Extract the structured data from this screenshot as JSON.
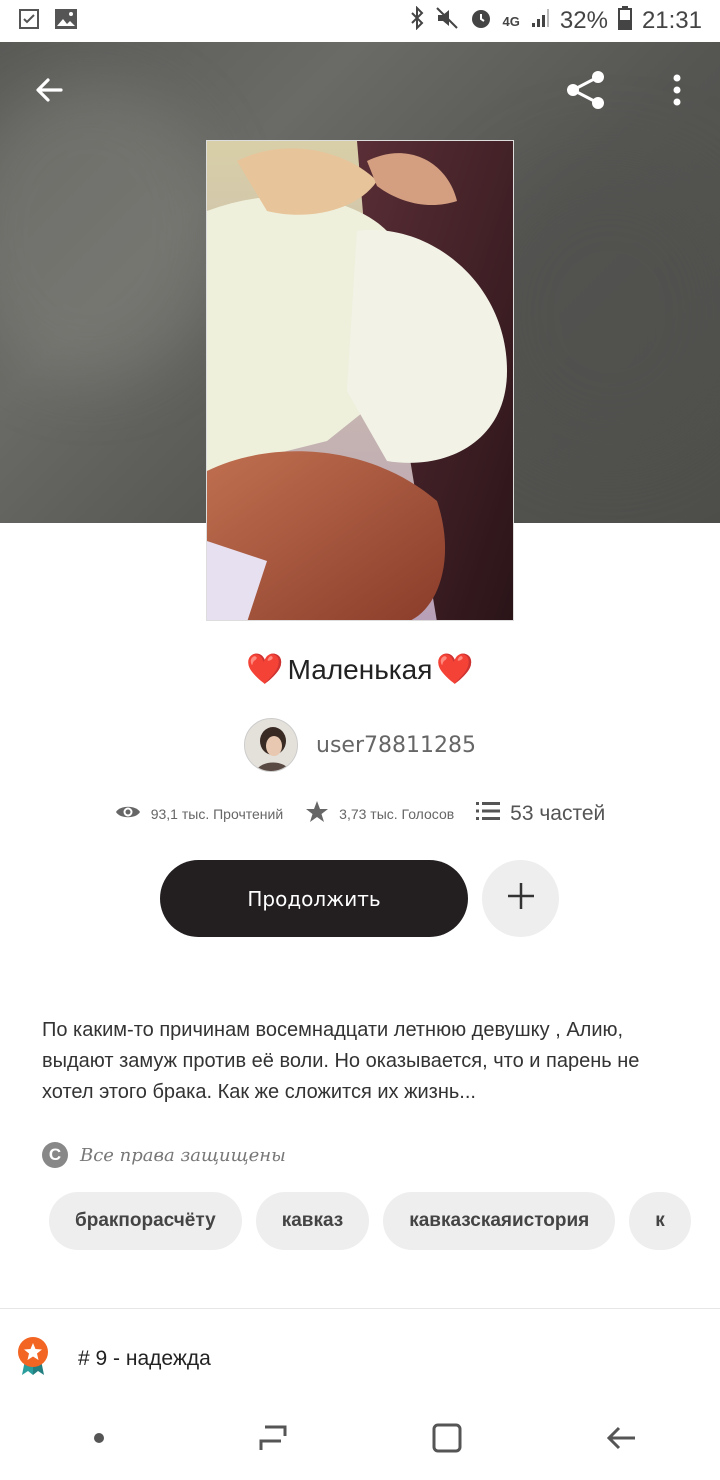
{
  "status_bar": {
    "network": "4G",
    "battery": "32%",
    "time": "21:31"
  },
  "book": {
    "title": "Маленькая",
    "title_heart": "❤️",
    "author": "user78811285",
    "reads": "93,1 тыс. Прочтений",
    "votes": "3,73 тыс. Голосов",
    "parts": "53 частей",
    "description": "По каким-то причинам восемнадцати летнюю девушку , Алию, выдают замуж против её воли. Но оказывается, что и парень не хотел этого брака. Как же сложится их жизнь...",
    "copyright": "Все права защищены",
    "tags": [
      "бракпорасчёту",
      "кавказ",
      "кавказскаяистория",
      "к"
    ],
    "rank": "# 9 - надежда"
  },
  "actions": {
    "continue_label": "Продолжить",
    "add_label": "+"
  },
  "colors": {
    "heart": "#e0262e",
    "button_dark": "#231f20",
    "rank_badge": "#f26522",
    "rank_ribbon": "#2a9d9d"
  },
  "icons": {
    "back": "arrow-left-icon",
    "share": "share-icon",
    "more": "more-vertical-icon",
    "reads": "eye-icon",
    "votes": "star-icon",
    "parts": "list-icon",
    "copyright": "copyright-icon",
    "rank": "award-badge-icon"
  }
}
